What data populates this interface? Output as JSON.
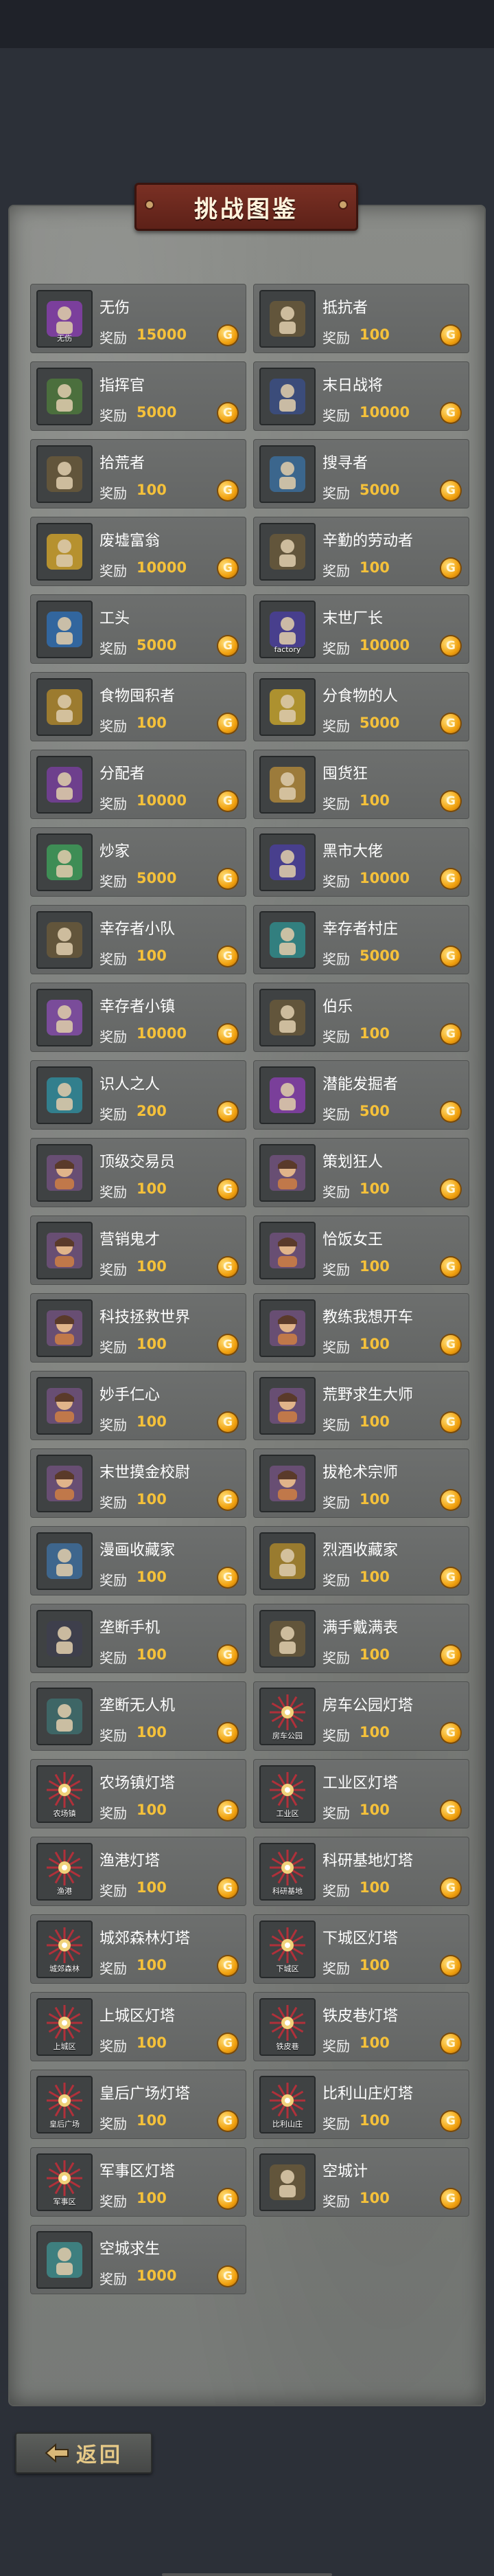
{
  "header": {
    "title": "挑战图鉴"
  },
  "reward_label": "奖励",
  "coin_symbol": "G",
  "achievements": [
    {
      "name": "无伤",
      "reward": "15000",
      "icon": "heart-shield-icon",
      "caption": "无伤",
      "color": "#8b3fb3"
    },
    {
      "name": "抵抗者",
      "reward": "100",
      "icon": "fist-raised-icon",
      "caption": "",
      "color": "#6b5a3a"
    },
    {
      "name": "指挥官",
      "reward": "5000",
      "icon": "commander-helmet-icon",
      "caption": "",
      "color": "#4f7a3c"
    },
    {
      "name": "末日战将",
      "reward": "10000",
      "icon": "general-cap-icon",
      "caption": "",
      "color": "#3b4f88"
    },
    {
      "name": "拾荒者",
      "reward": "100",
      "icon": "scavenger-figure-icon",
      "caption": "",
      "color": "#6b5a3a"
    },
    {
      "name": "搜寻者",
      "reward": "5000",
      "icon": "eye-coin-icon",
      "caption": "",
      "color": "#3b6fa0"
    },
    {
      "name": "废墟富翁",
      "reward": "10000",
      "icon": "crown-badge-icon",
      "caption": "",
      "color": "#d4a52a"
    },
    {
      "name": "辛勤的劳动者",
      "reward": "100",
      "icon": "hammer-worker-icon",
      "caption": "",
      "color": "#6b5a3a"
    },
    {
      "name": "工头",
      "reward": "5000",
      "icon": "foreman-helmet-icon",
      "caption": "",
      "color": "#2f6fb5"
    },
    {
      "name": "末世厂长",
      "reward": "10000",
      "icon": "factory-icon",
      "caption": "factory",
      "color": "#4b3fa0"
    },
    {
      "name": "食物囤积者",
      "reward": "100",
      "icon": "food-pile-icon",
      "caption": "",
      "color": "#b48a2a"
    },
    {
      "name": "分食物的人",
      "reward": "5000",
      "icon": "food-share-icon",
      "caption": "",
      "color": "#c9a52a"
    },
    {
      "name": "分配者",
      "reward": "10000",
      "icon": "scales-icon",
      "caption": "",
      "color": "#7a3fa0"
    },
    {
      "name": "囤货狂",
      "reward": "100",
      "icon": "sacks-icon",
      "caption": "",
      "color": "#b48a3a"
    },
    {
      "name": "炒家",
      "reward": "5000",
      "icon": "chart-figure-icon",
      "caption": "",
      "color": "#3fa05a"
    },
    {
      "name": "黑市大佬",
      "reward": "10000",
      "icon": "mafia-boss-icon",
      "caption": "",
      "color": "#4b3fa0"
    },
    {
      "name": "幸存者小队",
      "reward": "100",
      "icon": "survivor-team-icon",
      "caption": "",
      "color": "#6b5a3a"
    },
    {
      "name": "幸存者村庄",
      "reward": "5000",
      "icon": "survivor-village-icon",
      "caption": "",
      "color": "#2f8f8f"
    },
    {
      "name": "幸存者小镇",
      "reward": "10000",
      "icon": "survivor-town-icon",
      "caption": "",
      "color": "#8a4fb0"
    },
    {
      "name": "伯乐",
      "reward": "100",
      "icon": "horse-icon",
      "caption": "",
      "color": "#6b5a3a"
    },
    {
      "name": "识人之人",
      "reward": "200",
      "icon": "eye-target-icon",
      "caption": "",
      "color": "#2f8fa0"
    },
    {
      "name": "潜能发掘者",
      "reward": "500",
      "icon": "crowd-glow-icon",
      "caption": "",
      "color": "#8a3fb0"
    },
    {
      "name": "顶级交易员",
      "reward": "100",
      "icon": "trader-portrait-icon",
      "caption": "",
      "color": "#8a5a9a"
    },
    {
      "name": "策划狂人",
      "reward": "100",
      "icon": "planner-portrait-icon",
      "caption": "",
      "color": "#8a5a9a"
    },
    {
      "name": "营销鬼才",
      "reward": "100",
      "icon": "marketer-portrait-icon",
      "caption": "",
      "color": "#8a5a9a"
    },
    {
      "name": "恰饭女王",
      "reward": "100",
      "icon": "queen-portrait-icon",
      "caption": "",
      "color": "#8a5a9a"
    },
    {
      "name": "科技拯救世界",
      "reward": "100",
      "icon": "tech-portrait-icon",
      "caption": "",
      "color": "#8a5a9a"
    },
    {
      "name": "教练我想开车",
      "reward": "100",
      "icon": "driver-portrait-icon",
      "caption": "",
      "color": "#8a5a9a"
    },
    {
      "name": "妙手仁心",
      "reward": "100",
      "icon": "doctor-portrait-icon",
      "caption": "",
      "color": "#8a5a9a"
    },
    {
      "name": "荒野求生大师",
      "reward": "100",
      "icon": "wild-portrait-icon",
      "caption": "",
      "color": "#8a5a9a"
    },
    {
      "name": "末世摸金校尉",
      "reward": "100",
      "icon": "treasure-portrait-icon",
      "caption": "",
      "color": "#8a5a9a"
    },
    {
      "name": "拔枪术宗师",
      "reward": "100",
      "icon": "gunslinger-portrait-icon",
      "caption": "",
      "color": "#8a5a9a"
    },
    {
      "name": "漫画收藏家",
      "reward": "100",
      "icon": "comic-book-icon",
      "caption": "",
      "color": "#3f6fa0"
    },
    {
      "name": "烈酒收藏家",
      "reward": "100",
      "icon": "liquor-trophy-icon",
      "caption": "",
      "color": "#b08a2a"
    },
    {
      "name": "垄断手机",
      "reward": "100",
      "icon": "phone-icon",
      "caption": "",
      "color": "#3f3f4f"
    },
    {
      "name": "满手戴满表",
      "reward": "100",
      "icon": "watch-hand-icon",
      "caption": "",
      "color": "#6b5a3a"
    },
    {
      "name": "垄断无人机",
      "reward": "100",
      "icon": "drone-icon",
      "caption": "",
      "color": "#3f6f6f"
    },
    {
      "name": "房车公园灯塔",
      "reward": "100",
      "icon": "beacon-icon",
      "caption": "房车公园",
      "color": "#b0303a"
    },
    {
      "name": "农场镇灯塔",
      "reward": "100",
      "icon": "beacon-icon",
      "caption": "农场镇",
      "color": "#b0303a"
    },
    {
      "name": "工业区灯塔",
      "reward": "100",
      "icon": "beacon-icon",
      "caption": "工业区",
      "color": "#b0303a"
    },
    {
      "name": "渔港灯塔",
      "reward": "100",
      "icon": "beacon-icon",
      "caption": "渔港",
      "color": "#b0303a"
    },
    {
      "name": "科研基地灯塔",
      "reward": "100",
      "icon": "beacon-icon",
      "caption": "科研基地",
      "color": "#b0303a"
    },
    {
      "name": "城郊森林灯塔",
      "reward": "100",
      "icon": "beacon-icon",
      "caption": "城郊森林",
      "color": "#b0303a"
    },
    {
      "name": "下城区灯塔",
      "reward": "100",
      "icon": "beacon-icon",
      "caption": "下城区",
      "color": "#b0303a"
    },
    {
      "name": "上城区灯塔",
      "reward": "100",
      "icon": "beacon-icon",
      "caption": "上城区",
      "color": "#b0303a"
    },
    {
      "name": "铁皮巷灯塔",
      "reward": "100",
      "icon": "beacon-icon",
      "caption": "铁皮巷",
      "color": "#b0303a"
    },
    {
      "name": "皇后广场灯塔",
      "reward": "100",
      "icon": "beacon-icon",
      "caption": "皇后广场",
      "color": "#b0303a"
    },
    {
      "name": "比利山庄灯塔",
      "reward": "100",
      "icon": "beacon-icon",
      "caption": "比利山庄",
      "color": "#b0303a"
    },
    {
      "name": "军事区灯塔",
      "reward": "100",
      "icon": "beacon-icon",
      "caption": "军事区",
      "color": "#b0303a"
    },
    {
      "name": "空城计",
      "reward": "100",
      "icon": "empty-city-icon",
      "caption": "",
      "color": "#6b5a3a"
    },
    {
      "name": "空城求生",
      "reward": "1000",
      "icon": "city-survival-icon",
      "caption": "",
      "color": "#3f8f8f"
    }
  ],
  "footer": {
    "back_label": "返回"
  }
}
